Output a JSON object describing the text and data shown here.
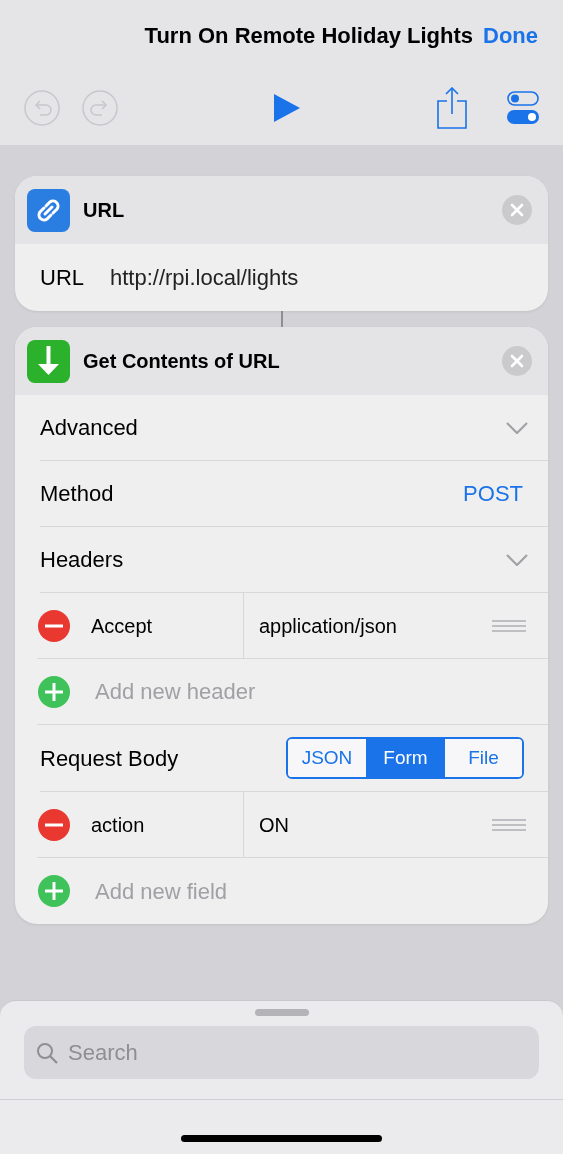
{
  "title": "Turn On Remote Holiday Lights",
  "done_button": "Done",
  "toolbar": {
    "undo": {
      "disabled": true
    },
    "redo": {
      "disabled": true
    }
  },
  "actions": [
    {
      "kind": "url",
      "title": "URL",
      "rows": [
        {
          "kind": "field",
          "label": "URL",
          "value": "http://rpi.local/lights"
        }
      ]
    },
    {
      "kind": "fetch",
      "title": "Get Contents of URL",
      "rows": [
        {
          "kind": "disclosure",
          "label": "Advanced"
        },
        {
          "kind": "value",
          "label": "Method",
          "value": "POST"
        },
        {
          "kind": "disclosure",
          "label": "Headers"
        },
        {
          "kind": "pair",
          "key": "Accept",
          "value": "application/json"
        },
        {
          "kind": "add",
          "placeholder": "Add new header"
        },
        {
          "kind": "segmented",
          "label": "Request Body",
          "options": [
            {
              "label": "JSON",
              "selected": false
            },
            {
              "label": "Form",
              "selected": true
            },
            {
              "label": "File",
              "selected": false
            }
          ]
        },
        {
          "kind": "pair",
          "key": "action",
          "value": "ON"
        },
        {
          "kind": "add",
          "placeholder": "Add new field"
        }
      ]
    }
  ],
  "search": {
    "placeholder": "Search"
  }
}
